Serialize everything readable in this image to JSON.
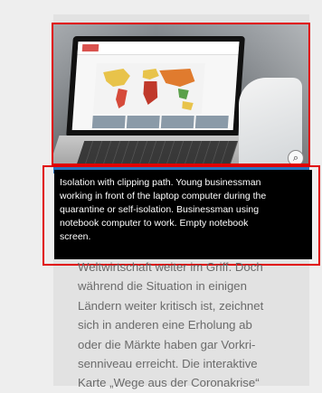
{
  "image": {
    "alt": "Isolation with clipping path. Young businessman working in front of the laptop computer during the quarantine or self-isolation. Businessman using notebook computer to work. Empty notebook screen."
  },
  "tooltip": {
    "lines": [
      "Isolation with clipping path. Young businessman",
      "working in front of the laptop computer during the",
      "quarantine or self-isolation. Businessman using",
      "notebook computer to work. Empty notebook",
      "screen."
    ]
  },
  "article": {
    "lines": [
      "Weltwirtschaft weiter im Griff. Doch",
      "während die Situation in einigen",
      "Ländern weiter kritisch ist, zeichnet",
      "sich in anderen eine Erholung ab",
      "oder die Märkte haben gar Vorkri-",
      "senniveau erreicht. Die interaktive",
      "Karte „Wege aus der Coronakrise“"
    ]
  },
  "colors": {
    "highlight": "#e00000",
    "accent_strip": "#2b76c1",
    "tooltip_bg": "#000000",
    "tooltip_text": "#ffffff",
    "body_text": "#6b6b6b"
  },
  "icons": {
    "zoom": "magnifier-icon"
  }
}
